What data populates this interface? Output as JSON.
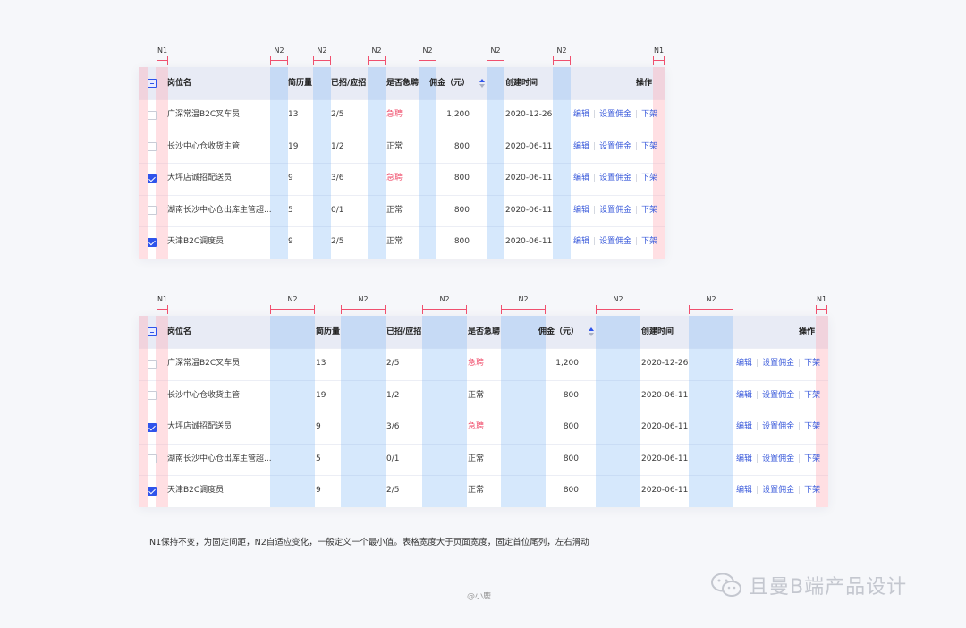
{
  "dimension_labels": {
    "fixed": "N1",
    "adaptive": "N2"
  },
  "table_top": {
    "columns": {
      "name": "岗位名",
      "resumes": "简历量",
      "hired": "已招/应招",
      "urgent": "是否急聘",
      "commission": "佣金（元）",
      "created": "创建时间",
      "ops": "操作"
    },
    "rows": [
      {
        "name": "广深常温B2C叉车员",
        "resumes": "13",
        "hired": "2/5",
        "urgent": "急聘",
        "commission": "1,200",
        "created": "2020-12-26",
        "checked": false
      },
      {
        "name": "长沙中心仓收货主管",
        "resumes": "19",
        "hired": "1/2",
        "urgent": "正常",
        "commission": "800",
        "created": "2020-06-11",
        "checked": false
      },
      {
        "name": "大坪店诚招配送员",
        "resumes": "9",
        "hired": "3/6",
        "urgent": "急聘",
        "commission": "800",
        "created": "2020-06-11",
        "checked": true
      },
      {
        "name": "湖南长沙中心仓出库主管超...",
        "resumes": "5",
        "hired": "0/1",
        "urgent": "正常",
        "commission": "800",
        "created": "2020-06-11",
        "checked": false
      },
      {
        "name": "天津B2C调度员",
        "resumes": "9",
        "hired": "2/5",
        "urgent": "正常",
        "commission": "800",
        "created": "2020-06-11",
        "checked": true
      }
    ],
    "actions": {
      "edit": "编辑",
      "set_commission": "设置佣金",
      "offline": "下架"
    }
  },
  "table_bottom": {
    "columns": {
      "name": "岗位名",
      "resumes": "简历量",
      "hired": "已招/应招",
      "urgent": "是否急聘",
      "commission": "佣金（元）",
      "created": "创建时间",
      "ops": "操作"
    },
    "rows": [
      {
        "name": "广深常温B2C叉车员",
        "resumes": "13",
        "hired": "2/5",
        "urgent": "急聘",
        "commission": "1,200",
        "created": "2020-12-26",
        "checked": false
      },
      {
        "name": "长沙中心仓收货主管",
        "resumes": "19",
        "hired": "1/2",
        "urgent": "正常",
        "commission": "800",
        "created": "2020-06-11",
        "checked": false
      },
      {
        "name": "大坪店诚招配送员",
        "resumes": "9",
        "hired": "3/6",
        "urgent": "急聘",
        "commission": "800",
        "created": "2020-06-11",
        "checked": true
      },
      {
        "name": "湖南长沙中心仓出库主管超...",
        "resumes": "5",
        "hired": "0/1",
        "urgent": "正常",
        "commission": "800",
        "created": "2020-06-11",
        "checked": false
      },
      {
        "name": "天津B2C调度员",
        "resumes": "9",
        "hired": "2/5",
        "urgent": "正常",
        "commission": "800",
        "created": "2020-06-11",
        "checked": true
      }
    ],
    "actions": {
      "edit": "编辑",
      "set_commission": "设置佣金",
      "offline": "下架"
    }
  },
  "note": "N1保持不变，为固定间距，N2自适应变化，一般定义一个最小值。表格宽度大于页面宽度，固定首位尾列，左右滑动",
  "credit": "@小鹿",
  "brand": {
    "text": "且曼B端产品设计",
    "icon": "wechat-icon"
  },
  "colors": {
    "accent": "#2f54eb",
    "urgent": "#f0506e",
    "header_bg": "#e8ebf5",
    "n1_marker": "#f0506e",
    "n2_band": "#b4d4f7"
  }
}
